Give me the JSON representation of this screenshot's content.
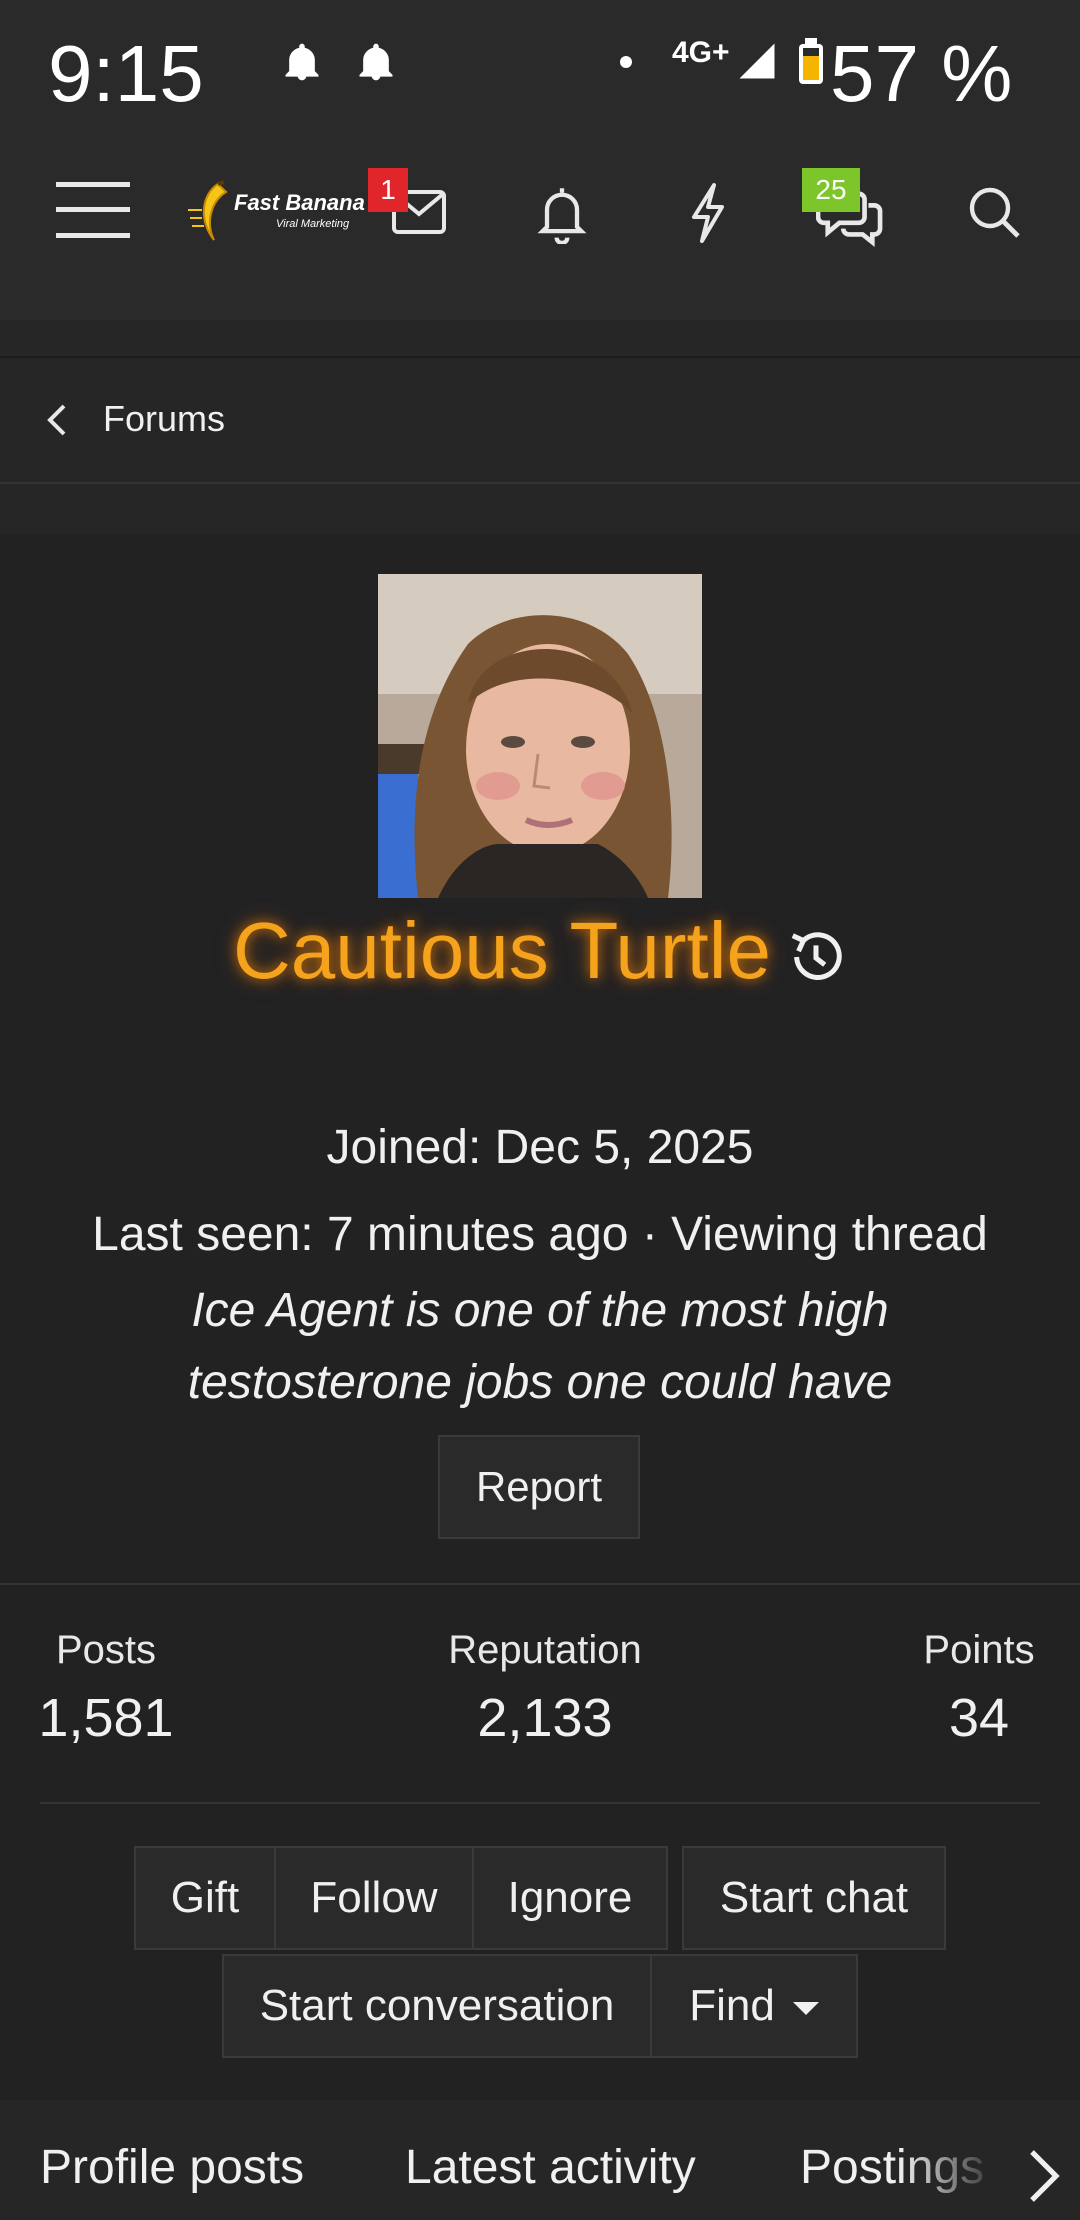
{
  "status_bar": {
    "time": "9:15",
    "network": "4G+",
    "battery": "57 %"
  },
  "nav": {
    "logo_text": "Fast Banana",
    "logo_subtext": "Viral Marketing",
    "inbox_badge": "1",
    "chat_badge": "25",
    "colors": {
      "inbox_badge": "#e0262b",
      "chat_badge": "#7cc52a"
    }
  },
  "breadcrumb": {
    "label": "Forums"
  },
  "profile": {
    "username": "Cautious Turtle",
    "username_color": "#f5a21c",
    "joined": "Joined: Dec 5, 2025",
    "last_seen": "Last seen: 7 minutes ago · Viewing thread",
    "tagline": "Ice Agent is one of the most high testosterone jobs one could have",
    "report_label": "Report"
  },
  "stats": [
    {
      "label": "Posts",
      "value": "1,581"
    },
    {
      "label": "Reputation",
      "value": "2,133"
    },
    {
      "label": "Points",
      "value": "34"
    }
  ],
  "actions": {
    "gift": "Gift",
    "follow": "Follow",
    "ignore": "Ignore",
    "start_chat": "Start chat",
    "start_conversation": "Start conversation",
    "find": "Find"
  },
  "tabs": [
    {
      "label": "Profile posts"
    },
    {
      "label": "Latest activity"
    },
    {
      "label": "Postings"
    }
  ]
}
